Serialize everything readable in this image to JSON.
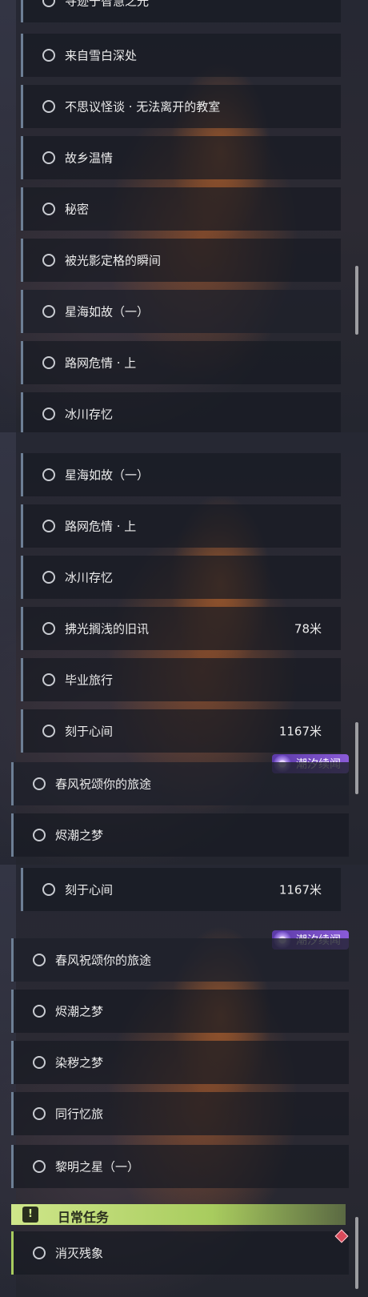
{
  "panels": [
    {
      "items": [
        {
          "label": "寻迹于智慧之光"
        },
        {
          "label": "来自雪白深处"
        },
        {
          "label": "不思议怪谈 · 无法离开的教室"
        },
        {
          "label": "故乡温情"
        },
        {
          "label": "秘密"
        },
        {
          "label": "被光影定格的瞬间"
        },
        {
          "label": "星海如故（一）"
        },
        {
          "label": "路网危情 · 上"
        },
        {
          "label": "冰川存忆"
        }
      ]
    },
    {
      "items": [
        {
          "label": "星海如故（一）"
        },
        {
          "label": "路网危情 · 上"
        },
        {
          "label": "冰川存忆"
        },
        {
          "label": "拂光搁浅的旧讯",
          "distance": "78米"
        },
        {
          "label": "毕业旅行"
        },
        {
          "label": "刻于心间",
          "distance": "1167米"
        },
        {
          "label": "春风祝颂你的旅途"
        },
        {
          "label": "烬潮之梦"
        }
      ],
      "badge": "潮汐续闻"
    },
    {
      "items": [
        {
          "label": "刻于心间",
          "distance": "1167米"
        },
        {
          "label": "春风祝颂你的旅途"
        },
        {
          "label": "烬潮之梦"
        },
        {
          "label": "染秽之梦"
        },
        {
          "label": "同行忆旅"
        },
        {
          "label": "黎明之星（一）"
        },
        {
          "label": "消灭残象"
        }
      ],
      "badge": "潮汐续闻",
      "section": {
        "title": "日常任务",
        "icon": "exclamation-icon"
      }
    }
  ],
  "colors": {
    "accent_border": "#6d7f95",
    "daily_green": "#a8cc5e",
    "badge_purple": "#7a4fd0"
  }
}
